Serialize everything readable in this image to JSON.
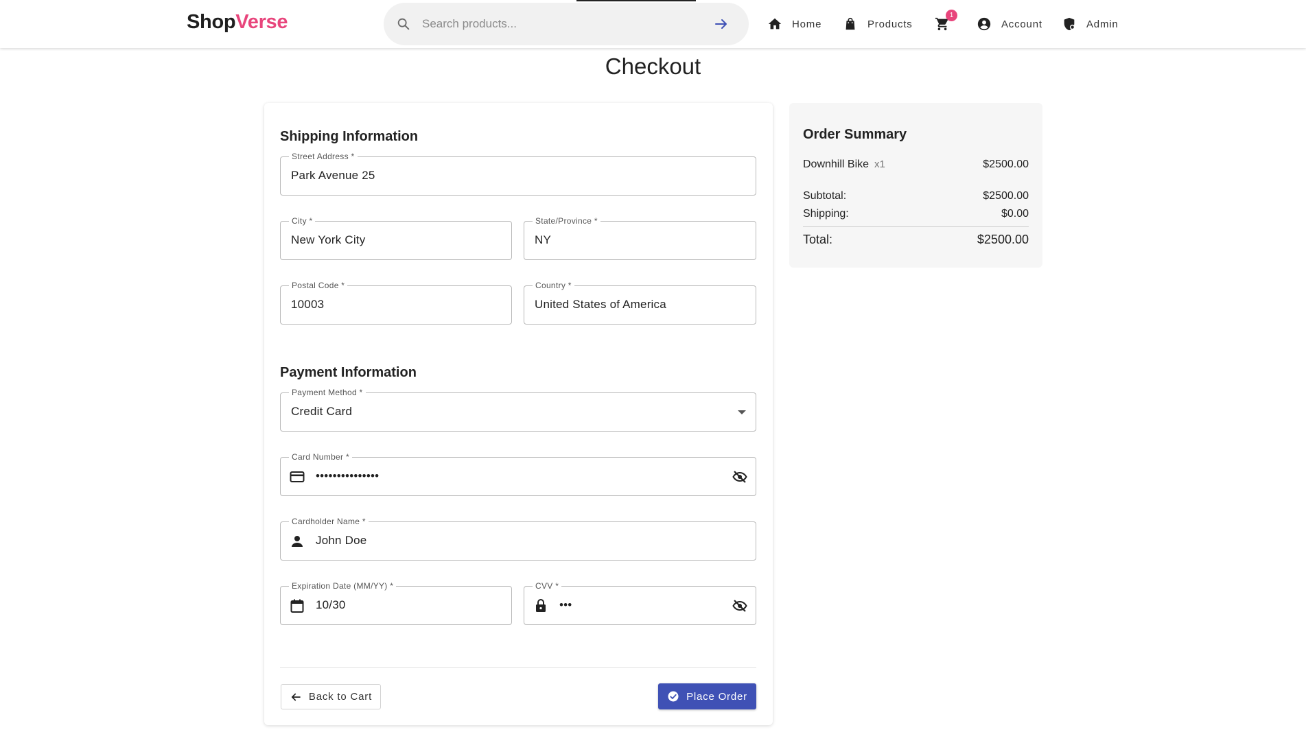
{
  "header": {
    "logo_part1": "Shop",
    "logo_part2": "Verse",
    "search_placeholder": "Search products...",
    "nav": {
      "home": "Home",
      "products": "Products",
      "account": "Account",
      "admin": "Admin",
      "cart_count": "1"
    }
  },
  "page_title": "Checkout",
  "shipping": {
    "title": "Shipping Information",
    "street": {
      "label": "Street Address *",
      "value": "Park Avenue 25"
    },
    "city": {
      "label": "City *",
      "value": "New York City"
    },
    "state": {
      "label": "State/Province *",
      "value": "NY"
    },
    "postal": {
      "label": "Postal Code *",
      "value": "10003"
    },
    "country": {
      "label": "Country *",
      "value": "United States of America"
    }
  },
  "payment": {
    "title": "Payment Information",
    "method": {
      "label": "Payment Method *",
      "value": "Credit Card"
    },
    "card_number": {
      "label": "Card Number *",
      "value": "•••••••••••••••"
    },
    "cardholder": {
      "label": "Cardholder Name *",
      "value": "John Doe"
    },
    "expiration": {
      "label": "Expiration Date (MM/YY) *",
      "value": "10/30"
    },
    "cvv": {
      "label": "CVV *",
      "value": "•••"
    }
  },
  "actions": {
    "back": "Back to Cart",
    "place": "Place Order"
  },
  "summary": {
    "title": "Order Summary",
    "item_name": "Downhill Bike",
    "item_qty": "x1",
    "item_price": "$2500.00",
    "subtotal_label": "Subtotal:",
    "subtotal_value": "$2500.00",
    "shipping_label": "Shipping:",
    "shipping_value": "$0.00",
    "total_label": "Total:",
    "total_value": "$2500.00"
  },
  "colors": {
    "brand_accent": "#e8457c",
    "primary_button": "#3f51b5"
  }
}
